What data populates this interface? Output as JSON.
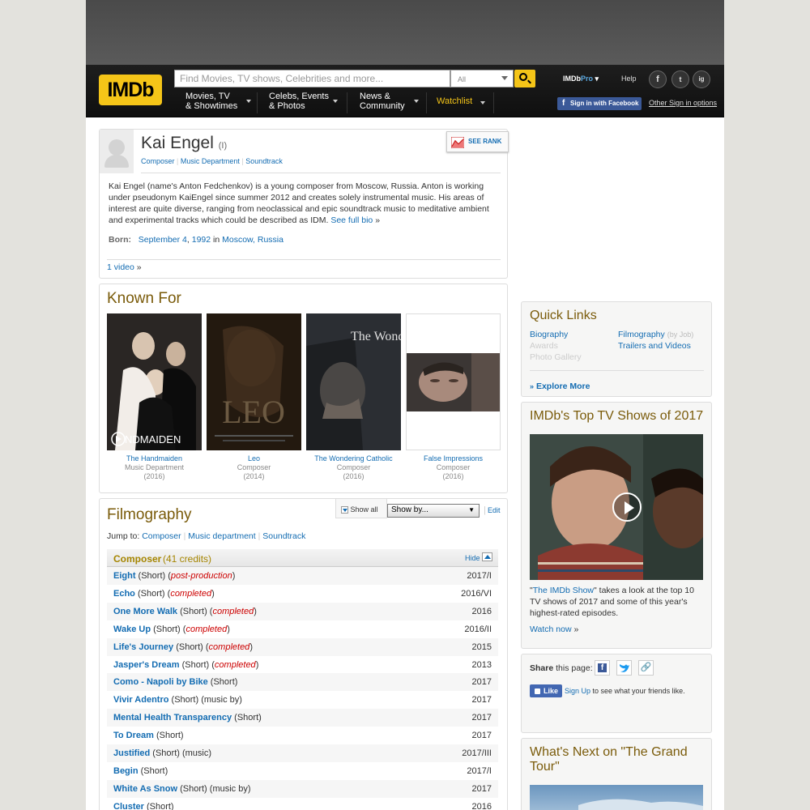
{
  "header": {
    "logo": "IMDb",
    "search_placeholder": "Find Movies, TV shows, Celebrities and more...",
    "search_category": "All",
    "nav": [
      {
        "label": "Movies, TV\n& Showtimes"
      },
      {
        "label": "Celebs, Events\n& Photos"
      },
      {
        "label": "News &\nCommunity"
      },
      {
        "label": "Watchlist"
      }
    ],
    "imdbpro_a": "IMDb",
    "imdbpro_b": "Pro",
    "help": "Help",
    "social": [
      "f",
      "t",
      "ig"
    ],
    "fb_signin": "Sign in with Facebook",
    "other_signin": "Other Sign in options"
  },
  "person": {
    "name": "Kai Engel",
    "suffix": "(I)",
    "jobs": [
      "Composer",
      "Music Department",
      "Soundtrack"
    ],
    "see_rank": "SEE RANK",
    "bio": "Kai Engel (name's Anton Fedchenkov) is a young composer from Moscow, Russia. Anton is working under pseudonym KaiEngel since summer 2012 and creates solely instrumental music. His areas of interest are quite diverse, ranging from neoclassical and epic soundtrack music to meditative ambient and experimental tracks which could be described as IDM.",
    "see_full_bio": "See full bio",
    "raquo": "»",
    "born_label": "Born:",
    "born_date": "September 4",
    "born_comma": ",",
    "born_year": "1992",
    "born_in": "in",
    "born_place": "Moscow, Russia",
    "video_link": "1 video",
    "video_raquo": "»"
  },
  "known_for": {
    "title": "Known For",
    "items": [
      {
        "title": "The Handmaiden",
        "role": "Music Department",
        "year": "(2016)"
      },
      {
        "title": "Leo",
        "role": "Composer",
        "year": "(2014)"
      },
      {
        "title": "The Wondering Catholic",
        "role": "Composer",
        "year": "(2016)"
      },
      {
        "title": "False Impressions",
        "role": "Composer",
        "year": "(2016)"
      }
    ],
    "poster_text_1": "NDMAIDEN",
    "poster_text_2": "LEO",
    "poster_text_3": "The Wondering Catholic"
  },
  "filmography": {
    "title": "Filmography",
    "show_all": "Show all",
    "show_by": "Show by...",
    "edit": "Edit",
    "jump_to": "Jump to:",
    "jump_links": [
      "Composer",
      "Music department",
      "Soundtrack"
    ],
    "section_title": "Composer",
    "section_count": "(41 credits)",
    "hide": "Hide",
    "credits": [
      {
        "title": "Eight",
        "tags": " (Short) (",
        "status": "post-production",
        "close": ")",
        "year": "2017/I"
      },
      {
        "title": "Echo",
        "tags": " (Short) (",
        "status": "completed",
        "close": ")",
        "year": "2016/VI"
      },
      {
        "title": "One More Walk",
        "tags": " (Short) (",
        "status": "completed",
        "close": ")",
        "year": "2016"
      },
      {
        "title": "Wake Up",
        "tags": " (Short) (",
        "status": "completed",
        "close": ")",
        "year": "2016/II"
      },
      {
        "title": "Life's Journey",
        "tags": " (Short) (",
        "status": "completed",
        "close": ")",
        "year": "2015"
      },
      {
        "title": "Jasper's Dream",
        "tags": " (Short) (",
        "status": "completed",
        "close": ")",
        "year": "2013"
      },
      {
        "title": "Como - Napoli by Bike",
        "tags": " (Short)",
        "status": "",
        "close": "",
        "year": "2017"
      },
      {
        "title": "Vivir Adentro",
        "tags": " (Short) (music by)",
        "status": "",
        "close": "",
        "year": "2017"
      },
      {
        "title": "Mental Health Transparency",
        "tags": " (Short)",
        "status": "",
        "close": "",
        "year": "2017"
      },
      {
        "title": "To Dream",
        "tags": " (Short)",
        "status": "",
        "close": "",
        "year": "2017"
      },
      {
        "title": "Justified",
        "tags": " (Short) (music)",
        "status": "",
        "close": "",
        "year": "2017/III"
      },
      {
        "title": "Begin",
        "tags": " (Short)",
        "status": "",
        "close": "",
        "year": "2017/I"
      },
      {
        "title": "White As Snow",
        "tags": " (Short) (music by)",
        "status": "",
        "close": "",
        "year": "2017"
      },
      {
        "title": "Cluster",
        "tags": " (Short)",
        "status": "",
        "close": "",
        "year": "2016"
      }
    ]
  },
  "quick_links": {
    "title": "Quick Links",
    "biography": "Biography",
    "filmography": "Filmography",
    "by_job": "(by Job)",
    "awards": "Awards",
    "trailers": "Trailers and Videos",
    "photo_gallery": "Photo Gallery",
    "explore_more": "Explore More"
  },
  "top_tv": {
    "title": "IMDb's Top TV Shows of 2017",
    "q1": "\"",
    "show_link": "The IMDb Show",
    "desc": "\" takes a look at the top 10 TV shows of 2017 and some of this year's highest-rated episodes.",
    "watch_now": "Watch now",
    "raquo": "»"
  },
  "share": {
    "label_bold": "Share",
    "label_rest": " this page:",
    "like": "Like",
    "sign_up": "Sign Up",
    "like_rest": " to see what your friends like."
  },
  "whats_next": {
    "title": "What's Next on \"The Grand Tour\""
  }
}
